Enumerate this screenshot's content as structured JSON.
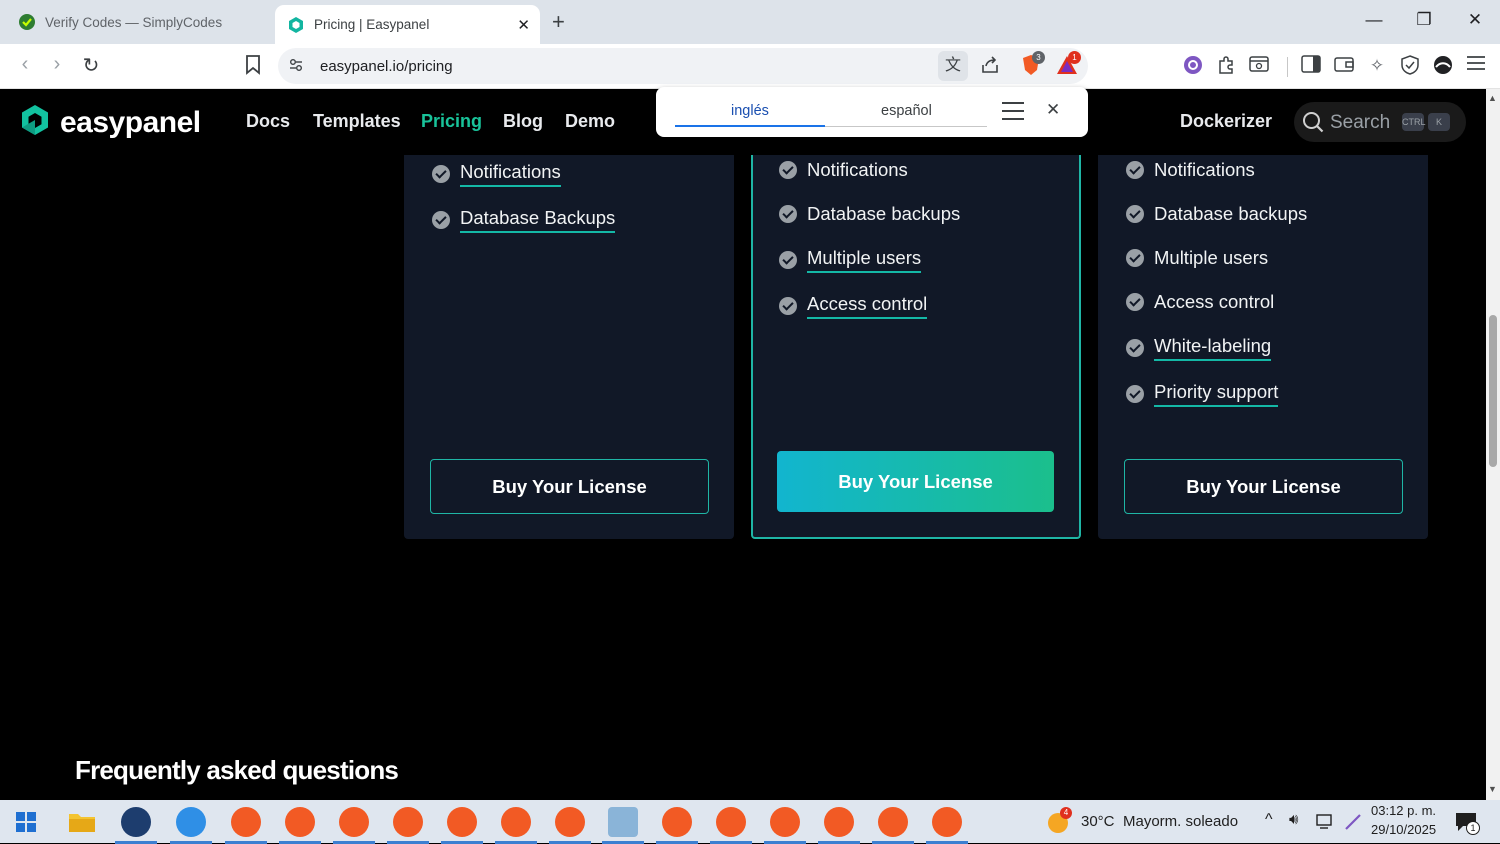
{
  "browser": {
    "tabs": [
      {
        "title": "Verify Codes — SimplyCodes",
        "active": false
      },
      {
        "title": "Pricing | Easypanel",
        "active": true
      }
    ],
    "url": "easypanel.io/pricing",
    "badges": {
      "brave_shields": "3",
      "rewards": "1"
    }
  },
  "site": {
    "logo": "easypanel",
    "nav": [
      "Docs",
      "Templates",
      "Pricing",
      "Blog",
      "Demo",
      "Dockerizer"
    ],
    "active_nav": "Pricing",
    "search": {
      "label": "Search",
      "shortcut": [
        "CTRL",
        "K"
      ]
    }
  },
  "translate_popup": {
    "languages": [
      "inglés",
      "español"
    ],
    "selected": "inglés"
  },
  "pricing_cards": [
    {
      "features": [
        "Notifications",
        "Database Backups"
      ],
      "cta": "Buy Your License"
    },
    {
      "features": [
        "Notifications",
        "Database backups",
        "Multiple users",
        "Access control"
      ],
      "cta": "Buy Your License",
      "highlighted": true
    },
    {
      "features": [
        "Notifications",
        "Database backups",
        "Multiple users",
        "Access control",
        "White-labeling",
        "Priority support"
      ],
      "cta": "Buy Your License"
    }
  ],
  "faq": {
    "title": "Frequently asked questions"
  },
  "taskbar": {
    "weather": {
      "temp": "30°C",
      "desc": "Mayorm. soleado",
      "badge": "4"
    },
    "time": "03:12 p. m.",
    "date": "29/10/2025",
    "notifications": "1"
  },
  "colors": {
    "accent": "#19c39a",
    "card_bg": "#111827",
    "highlight_border": "#1fb5a5"
  }
}
